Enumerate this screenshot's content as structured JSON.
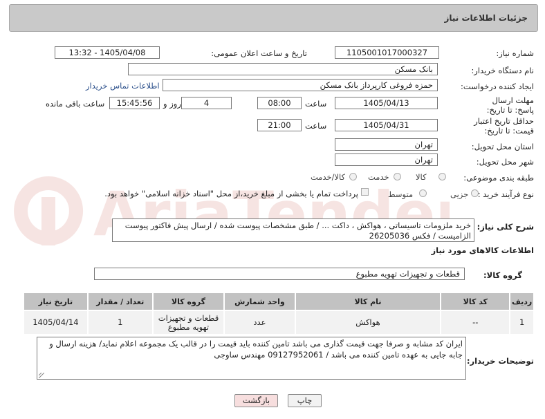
{
  "panel_title": "جزئیات اطلاعات نیاز",
  "labels": {
    "need_number": "شماره نیاز:",
    "announce_datetime": "تاریخ و ساعت اعلان عمومی:",
    "buyer_org": "نام دستگاه خریدار:",
    "creator": "ایجاد کننده درخواست:",
    "reply_deadline": "مهلت ارسال پاسخ: تا تاریخ:",
    "price_validity": "حداقل تاریخ اعتبار قیمت: تا تاریخ:",
    "time": "ساعت",
    "day_and": "روز و",
    "remaining": "ساعت باقی مانده",
    "province": "استان محل تحویل:",
    "city": "شهر محل تحویل:",
    "category": "طبقه بندی موضوعی:",
    "process_type": "نوع فرآیند خرید :",
    "general_desc": "شرح کلی نیاز:",
    "goods_info": "اطلاعات کالاهای مورد نیاز",
    "goods_group": "گروه کالا:",
    "buyer_notes": "توضیحات خریدار:"
  },
  "values": {
    "need_number": "1105001017000327",
    "announce_datetime": "1405/04/08 - 13:32",
    "buyer_org": "بانک مسکن",
    "creator": "حمزه فروغی کارپرداز بانک مسکن",
    "buyer_contact_link": "اطلاعات تماس خریدار",
    "reply_date": "1405/04/13",
    "reply_time": "08:00",
    "remaining_days": "4",
    "remaining_time": "15:45:56",
    "validity_date": "1405/04/31",
    "validity_time": "21:00",
    "province": "تهران",
    "city": "تهران",
    "goods_group": "قطعات و تجهیزات تهویه مطبوع"
  },
  "category_options": [
    "کالا",
    "خدمت",
    "کالا/خدمت"
  ],
  "process_options": [
    "جزیی",
    "متوسط"
  ],
  "payment_note": "پرداخت تمام یا بخشی از مبلغ خرید،از محل \"اسناد خزانه اسلامی\" خواهد بود.",
  "general_desc_text": "خرید ملزومات تاسیساتی ، هواکش ، داکت ... / طبق مشخصات پیوست شده / ارسال پیش فاکتور پیوست الزامیست / فکس 26205036",
  "table": {
    "headers": [
      "ردیف",
      "کد کالا",
      "نام کالا",
      "واحد شمارش",
      "گروه کالا",
      "تعداد / مقدار",
      "تاریخ نیاز"
    ],
    "rows": [
      {
        "row": "1",
        "code": "--",
        "name": "هواکش",
        "unit": "عدد",
        "group": "قطعات و تجهیزات تهویه مطبوع",
        "qty": "1",
        "date": "1405/04/14"
      }
    ]
  },
  "buyer_notes_text": "ایران کد مشابه و صرفا جهت قیمت گذاری می باشد تامین کننده باید قیمت را در قالب یک مجموعه اعلام نماید/ هزینه ارسال و جابه جایی به عهده تامین کننده می باشد / 09127952061 مهندس ساوجی",
  "buttons": {
    "print": "چاپ",
    "back": "بازگشت"
  },
  "watermark_text": "AriaTender.net",
  "colors": {
    "header_bg": "#c9c9c9",
    "link": "#2a4e8a",
    "back_button_bg": "#f7dede",
    "watermark": "#c0392b"
  }
}
